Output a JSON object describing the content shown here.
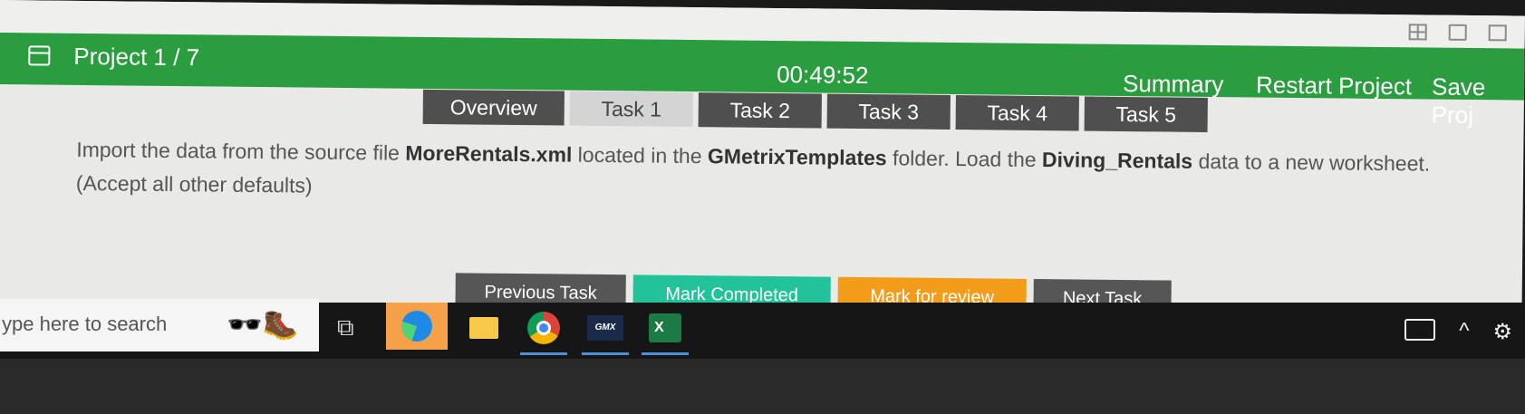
{
  "header": {
    "project_label": "Project 1 / 7",
    "timer": "00:49:52",
    "summary": "Summary",
    "restart": "Restart Project",
    "save": "Save Proj"
  },
  "tabs": [
    {
      "label": "Overview"
    },
    {
      "label": "Task 1"
    },
    {
      "label": "Task 2"
    },
    {
      "label": "Task 3"
    },
    {
      "label": "Task 4"
    },
    {
      "label": "Task 5"
    }
  ],
  "instruction": {
    "t1": "Import the data from the source file ",
    "b1": "MoreRentals.xml",
    "t2": " located in the ",
    "b2": "GMetrixTemplates",
    "t3": " folder. Load the ",
    "b3": "Diving_Rentals",
    "t4": " data to a new worksheet. (Accept all other defaults)"
  },
  "actions": {
    "previous": "Previous Task",
    "mark_completed": "Mark Completed",
    "mark_review": "Mark for review",
    "next": "Next Task"
  },
  "taskbar": {
    "search_text": "ype here to search",
    "gmx_label": "GMX",
    "excel_label": "X"
  },
  "colors": {
    "header_green": "#2a9d3f",
    "tab_dark": "#4f4f4f",
    "tab_active": "#d4d4d4",
    "mark_completed": "#22c39a",
    "mark_review": "#f39c1a"
  }
}
